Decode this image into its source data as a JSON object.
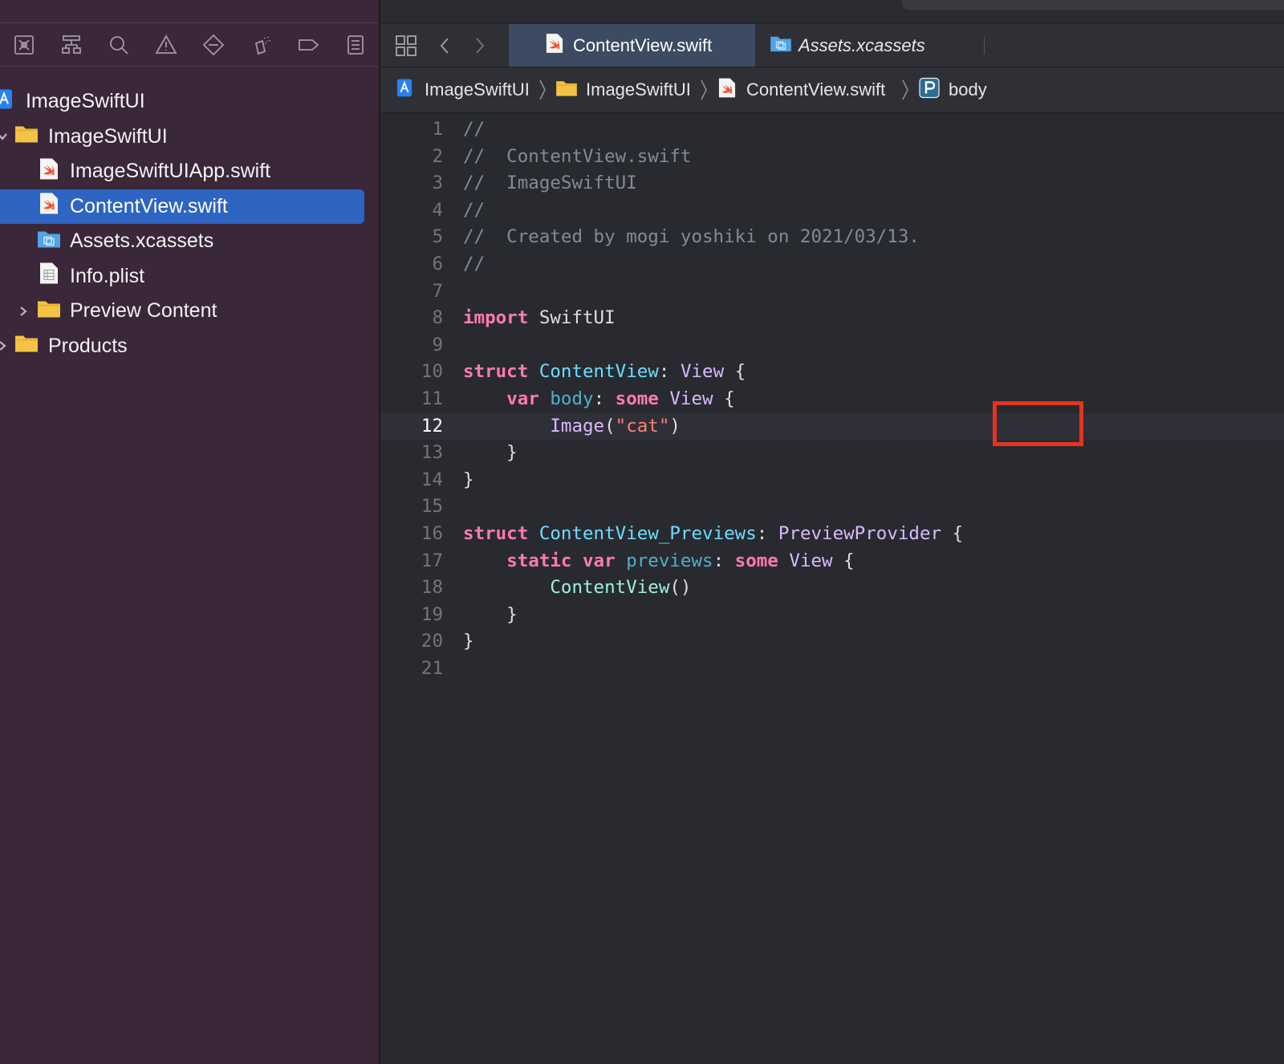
{
  "navigator": {
    "toolbar_icons": [
      "project-navigator-icon",
      "source-control-icon",
      "find-icon",
      "issue-icon",
      "test-icon",
      "debug-icon",
      "breakpoint-icon",
      "report-icon"
    ],
    "tree": [
      {
        "label": "ImageSwiftUI",
        "icon": "project-icon",
        "level": 0
      },
      {
        "label": "ImageSwiftUI",
        "icon": "folder-icon",
        "level": 1,
        "expanded": true
      },
      {
        "label": "ImageSwiftUIApp.swift",
        "icon": "swift-file-icon",
        "level": 2
      },
      {
        "label": "ContentView.swift",
        "icon": "swift-file-icon",
        "level": 2,
        "selected": true
      },
      {
        "label": "Assets.xcassets",
        "icon": "asset-catalog-icon",
        "level": 2
      },
      {
        "label": "Info.plist",
        "icon": "plist-icon",
        "level": 2
      },
      {
        "label": "Preview Content",
        "icon": "folder-icon",
        "level": 2,
        "expanded": false
      },
      {
        "label": "Products",
        "icon": "folder-icon",
        "level": 1,
        "expanded": false
      }
    ]
  },
  "tabs": [
    {
      "label": "ContentView.swift",
      "active": true
    },
    {
      "label": "Assets.xcassets",
      "active": false
    }
  ],
  "jumpbar": [
    "ImageSwiftUI",
    "ImageSwiftUI",
    "ContentView.swift",
    "body"
  ],
  "editor": {
    "current_line": 12,
    "lines": [
      {
        "n": "1",
        "text": "//"
      },
      {
        "n": "2",
        "text": "//  ContentView.swift"
      },
      {
        "n": "3",
        "text": "//  ImageSwiftUI"
      },
      {
        "n": "4",
        "text": "//"
      },
      {
        "n": "5",
        "text": "//  Created by mogi yoshiki on 2021/03/13."
      },
      {
        "n": "6",
        "text": "//"
      },
      {
        "n": "7",
        "text": ""
      },
      {
        "n": "8",
        "text": "import SwiftUI"
      },
      {
        "n": "9",
        "text": ""
      },
      {
        "n": "10",
        "text": "struct ContentView: View {"
      },
      {
        "n": "11",
        "text": "    var body: some View {"
      },
      {
        "n": "12",
        "text": "        Image(\"cat\")"
      },
      {
        "n": "13",
        "text": "    }"
      },
      {
        "n": "14",
        "text": "}"
      },
      {
        "n": "15",
        "text": ""
      },
      {
        "n": "16",
        "text": "struct ContentView_Previews: PreviewProvider {"
      },
      {
        "n": "17",
        "text": "    static var previews: some View {"
      },
      {
        "n": "18",
        "text": "        ContentView()"
      },
      {
        "n": "19",
        "text": "    }"
      },
      {
        "n": "20",
        "text": "}"
      },
      {
        "n": "21",
        "text": ""
      }
    ]
  },
  "annotation": {
    "color": "#e5331e",
    "target": "\"cat\""
  },
  "colors": {
    "sidebar_bg": "#3a2739",
    "editor_bg": "#292a30",
    "selection": "#2e64c2",
    "keyword": "#ff7ab2",
    "string": "#ff8170",
    "comment": "#7f8c98"
  }
}
